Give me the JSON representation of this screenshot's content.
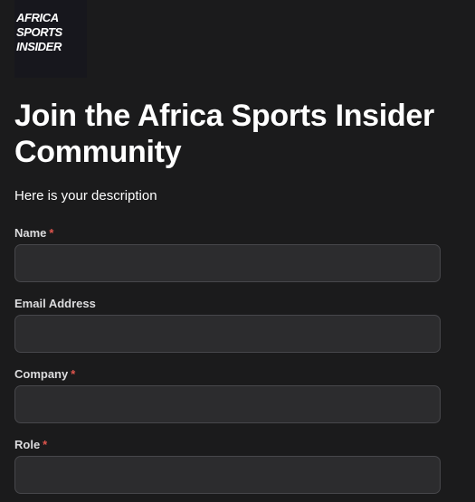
{
  "logo": {
    "lines": [
      "AFRICA",
      "SPORTS",
      "INSIDER"
    ]
  },
  "form": {
    "title": "Join the Africa Sports Insider Community",
    "description": "Here is your description",
    "required_marker": "*",
    "fields": [
      {
        "label": "Name",
        "required": true,
        "value": "",
        "placeholder": ""
      },
      {
        "label": "Email Address",
        "required": false,
        "value": "",
        "placeholder": ""
      },
      {
        "label": "Company",
        "required": true,
        "value": "",
        "placeholder": ""
      },
      {
        "label": "Role",
        "required": true,
        "value": "",
        "placeholder": ""
      }
    ]
  },
  "colors": {
    "background": "#1b1b1c",
    "input_background": "#2c2c2e",
    "input_border": "#47474b",
    "required": "#e0554d",
    "text": "#ffffff"
  }
}
